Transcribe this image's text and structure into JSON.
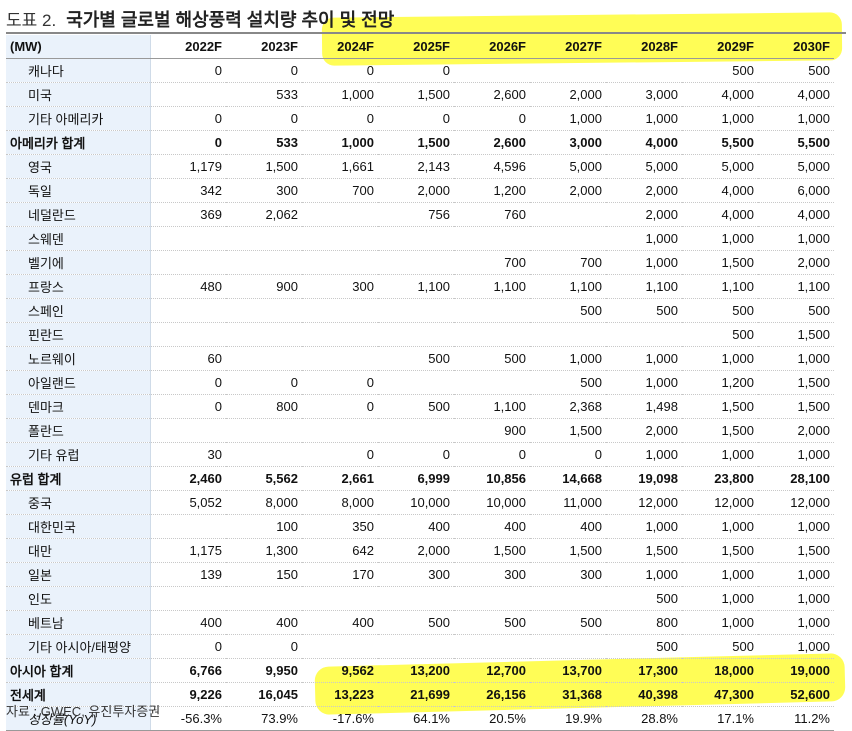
{
  "title": {
    "prefix": "도표 2.",
    "text": "국가별 글로벌 해상풍력 설치량 추이 및 전망"
  },
  "table": {
    "unit": "(MW)",
    "columns": [
      "2022F",
      "2023F",
      "2024F",
      "2025F",
      "2026F",
      "2027F",
      "2028F",
      "2029F",
      "2030F"
    ],
    "rows": [
      {
        "label": "캐나다",
        "style": "indent",
        "values": [
          "0",
          "0",
          "0",
          "0",
          "",
          "",
          "",
          "500",
          "500"
        ]
      },
      {
        "label": "미국",
        "style": "indent",
        "values": [
          "",
          "533",
          "1,000",
          "1,500",
          "2,600",
          "2,000",
          "3,000",
          "4,000",
          "4,000"
        ]
      },
      {
        "label": "기타 아메리카",
        "style": "indent",
        "values": [
          "0",
          "0",
          "0",
          "0",
          "0",
          "1,000",
          "1,000",
          "1,000",
          "1,000"
        ]
      },
      {
        "label": "아메리카 합계",
        "style": "bold",
        "values": [
          "0",
          "533",
          "1,000",
          "1,500",
          "2,600",
          "3,000",
          "4,000",
          "5,500",
          "5,500"
        ]
      },
      {
        "label": "영국",
        "style": "indent",
        "values": [
          "1,179",
          "1,500",
          "1,661",
          "2,143",
          "4,596",
          "5,000",
          "5,000",
          "5,000",
          "5,000"
        ]
      },
      {
        "label": "독일",
        "style": "indent",
        "values": [
          "342",
          "300",
          "700",
          "2,000",
          "1,200",
          "2,000",
          "2,000",
          "4,000",
          "6,000"
        ]
      },
      {
        "label": "네덜란드",
        "style": "indent",
        "values": [
          "369",
          "2,062",
          "",
          "756",
          "760",
          "",
          "2,000",
          "4,000",
          "4,000"
        ]
      },
      {
        "label": "스웨덴",
        "style": "indent",
        "values": [
          "",
          "",
          "",
          "",
          "",
          "",
          "1,000",
          "1,000",
          "1,000"
        ]
      },
      {
        "label": "벨기에",
        "style": "indent",
        "values": [
          "",
          "",
          "",
          "",
          "700",
          "700",
          "1,000",
          "1,500",
          "2,000"
        ]
      },
      {
        "label": "프랑스",
        "style": "indent",
        "values": [
          "480",
          "900",
          "300",
          "1,100",
          "1,100",
          "1,100",
          "1,100",
          "1,100",
          "1,100"
        ]
      },
      {
        "label": "스페인",
        "style": "indent",
        "values": [
          "",
          "",
          "",
          "",
          "",
          "500",
          "500",
          "500",
          "500"
        ]
      },
      {
        "label": "핀란드",
        "style": "indent",
        "values": [
          "",
          "",
          "",
          "",
          "",
          "",
          "",
          "500",
          "1,500"
        ]
      },
      {
        "label": "노르웨이",
        "style": "indent",
        "values": [
          "60",
          "",
          "",
          "500",
          "500",
          "1,000",
          "1,000",
          "1,000",
          "1,000"
        ]
      },
      {
        "label": "아일랜드",
        "style": "indent",
        "values": [
          "0",
          "0",
          "0",
          "",
          "",
          "500",
          "1,000",
          "1,200",
          "1,500"
        ]
      },
      {
        "label": "덴마크",
        "style": "indent",
        "values": [
          "0",
          "800",
          "0",
          "500",
          "1,100",
          "2,368",
          "1,498",
          "1,500",
          "1,500"
        ]
      },
      {
        "label": "폴란드",
        "style": "indent",
        "values": [
          "",
          "",
          "",
          "",
          "900",
          "1,500",
          "2,000",
          "1,500",
          "2,000"
        ]
      },
      {
        "label": "기타 유럽",
        "style": "indent",
        "values": [
          "30",
          "",
          "0",
          "0",
          "0",
          "0",
          "1,000",
          "1,000",
          "1,000"
        ]
      },
      {
        "label": "유럽 합계",
        "style": "bold",
        "values": [
          "2,460",
          "5,562",
          "2,661",
          "6,999",
          "10,856",
          "14,668",
          "19,098",
          "23,800",
          "28,100"
        ]
      },
      {
        "label": "중국",
        "style": "indent",
        "values": [
          "5,052",
          "8,000",
          "8,000",
          "10,000",
          "10,000",
          "11,000",
          "12,000",
          "12,000",
          "12,000"
        ]
      },
      {
        "label": "대한민국",
        "style": "indent",
        "values": [
          "",
          "100",
          "350",
          "400",
          "400",
          "400",
          "1,000",
          "1,000",
          "1,000"
        ]
      },
      {
        "label": "대만",
        "style": "indent",
        "values": [
          "1,175",
          "1,300",
          "642",
          "2,000",
          "1,500",
          "1,500",
          "1,500",
          "1,500",
          "1,500"
        ]
      },
      {
        "label": "일본",
        "style": "indent",
        "values": [
          "139",
          "150",
          "170",
          "300",
          "300",
          "300",
          "1,000",
          "1,000",
          "1,000"
        ]
      },
      {
        "label": "인도",
        "style": "indent",
        "values": [
          "",
          "",
          "",
          "",
          "",
          "",
          "500",
          "1,000",
          "1,000"
        ]
      },
      {
        "label": "베트남",
        "style": "indent",
        "values": [
          "400",
          "400",
          "400",
          "500",
          "500",
          "500",
          "800",
          "1,000",
          "1,000"
        ]
      },
      {
        "label": "기타 아시아/태평양",
        "style": "indent",
        "values": [
          "0",
          "0",
          "",
          "",
          "",
          "",
          "500",
          "500",
          "1,000"
        ]
      },
      {
        "label": "아시아 합계",
        "style": "bold",
        "values": [
          "6,766",
          "9,950",
          "9,562",
          "13,200",
          "12,700",
          "13,700",
          "17,300",
          "18,000",
          "19,000"
        ]
      },
      {
        "label": "전세계",
        "style": "bold",
        "values": [
          "9,226",
          "16,045",
          "13,223",
          "21,699",
          "26,156",
          "31,368",
          "40,398",
          "47,300",
          "52,600"
        ]
      },
      {
        "label": "성장률(YoY)",
        "style": "italic",
        "values": [
          "-56.3%",
          "73.9%",
          "-17.6%",
          "64.1%",
          "20.5%",
          "19.9%",
          "28.8%",
          "17.1%",
          "11.2%"
        ]
      }
    ]
  },
  "source": "자료 : GWEC, 유진투자증권",
  "colors": {
    "highlight": "#fffd38",
    "label_column_bg": "#eaf2fb"
  }
}
